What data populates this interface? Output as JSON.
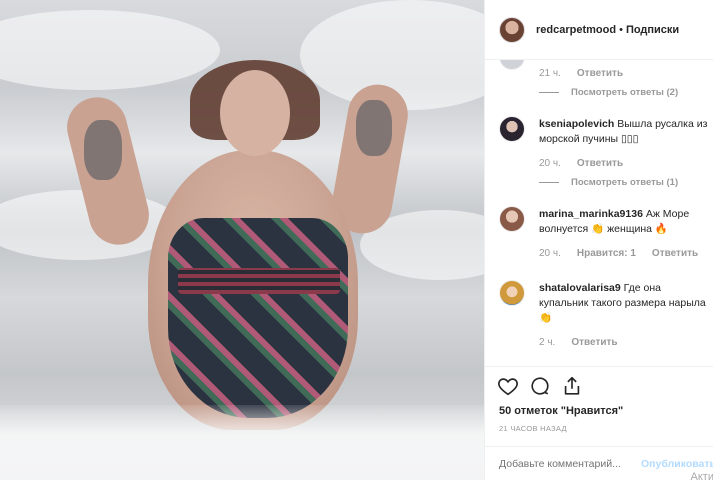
{
  "post": {
    "username": "redcarpetmood",
    "separator": "•",
    "follow_label": "Подписки"
  },
  "comments": [
    {
      "partial": true,
      "time": "21 ч.",
      "reply_label": "Ответить",
      "view_replies": "Посмотреть ответы (2)"
    },
    {
      "username": "kseniapolevich",
      "text": "Вышла русалка из морской пучины ▯▯▯",
      "time": "20 ч.",
      "reply_label": "Ответить",
      "view_replies": "Посмотреть ответы (1)"
    },
    {
      "username": "marina_marinka9136",
      "text": "Аж Море волнуется 👏 женщина 🔥",
      "time": "20 ч.",
      "likes_label": "Нравится: 1",
      "reply_label": "Ответить"
    },
    {
      "username": "shatalovalarisa9",
      "text": "Где она купальник такого размера нарыла👏",
      "time": "2 ч.",
      "reply_label": "Ответить"
    }
  ],
  "actions": {
    "likes_text": "50 отметок \"Нравится\"",
    "time_ago": "21 ЧАСОВ НАЗАД",
    "icons": [
      "heart-icon",
      "comment-icon",
      "share-icon"
    ]
  },
  "add_comment": {
    "placeholder": "Добавьте комментарий...",
    "publish_label": "Опубликовать",
    "watermark": "Акти"
  },
  "colors": {
    "link_blue": "#b3dbff",
    "muted_gray": "#999999",
    "text": "#262626"
  }
}
